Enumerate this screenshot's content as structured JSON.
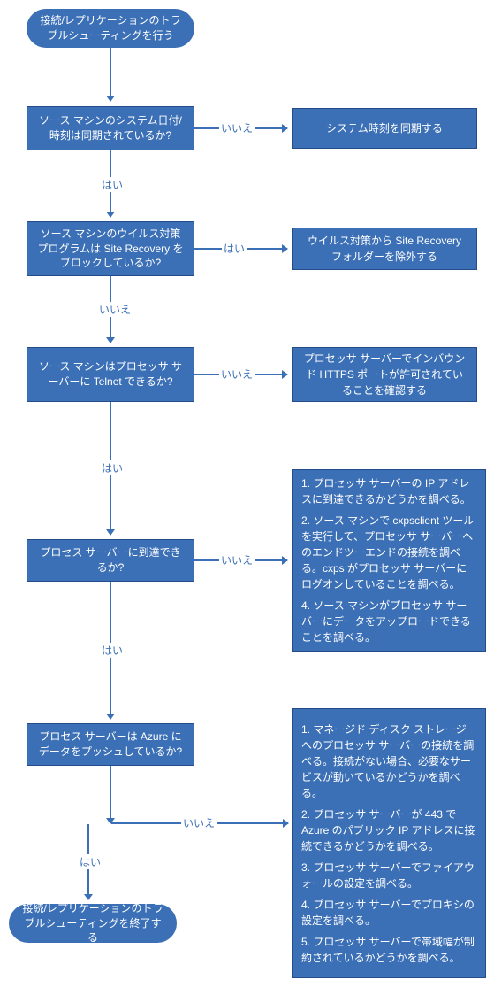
{
  "start": "接続/レプリケーションのトラブルシューティングを行う",
  "end": "接続/レプリケーションのトラブルシューティングを終了する",
  "labels": {
    "yes": "はい",
    "no": "いいえ"
  },
  "q1": "ソース マシンのシステム日付/時刻は同期されているか?",
  "a1": "システム時刻を同期する",
  "q2": "ソース マシンのウイルス対策プログラムは Site Recovery をブロックしているか?",
  "a2": "ウイルス対策から Site Recovery フォルダーを除外する",
  "q3": "ソース マシンはプロセッサ サーバーに Telnet できるか?",
  "a3": "プロセッサ サーバーでインバウンド HTTPS ポートが許可されていることを確認する",
  "q4": "プロセス サーバーに到達できるか?",
  "a4": {
    "l1": "1. プロセッサ サーバーの IP アドレスに到達できるかどうかを調べる。",
    "l2": "2. ソース マシンで cxpsclient ツールを実行して、プロセッサ サーバーへのエンドツーエンドの接続を調べる。cxps がプロセッサ サーバーにログオンしていることを調べる。",
    "l3": "4. ソース マシンがプロセッサ サーバーにデータをアップロードできることを調べる。"
  },
  "q5": "プロセス サーバーは Azure にデータをプッシュしているか?",
  "a5": {
    "l1": "1. マネージド ディスク ストレージへのプロセッサ サーバーの接続を調べる。接続がない場合、必要なサービスが動いているかどうかを調べる。",
    "l2": "2. プロセッサ サーバーが 443 で Azure のパブリック IP アドレスに接続できるかどうかを調べる。",
    "l3": "3. プロセッサ サーバーでファイアウォールの設定を調べる。",
    "l4": "4. プロセッサ サーバーでプロキシの設定を調べる。",
    "l5": "5. プロセッサ サーバーで帯域幅が制約されているかどうかを調べる。"
  }
}
